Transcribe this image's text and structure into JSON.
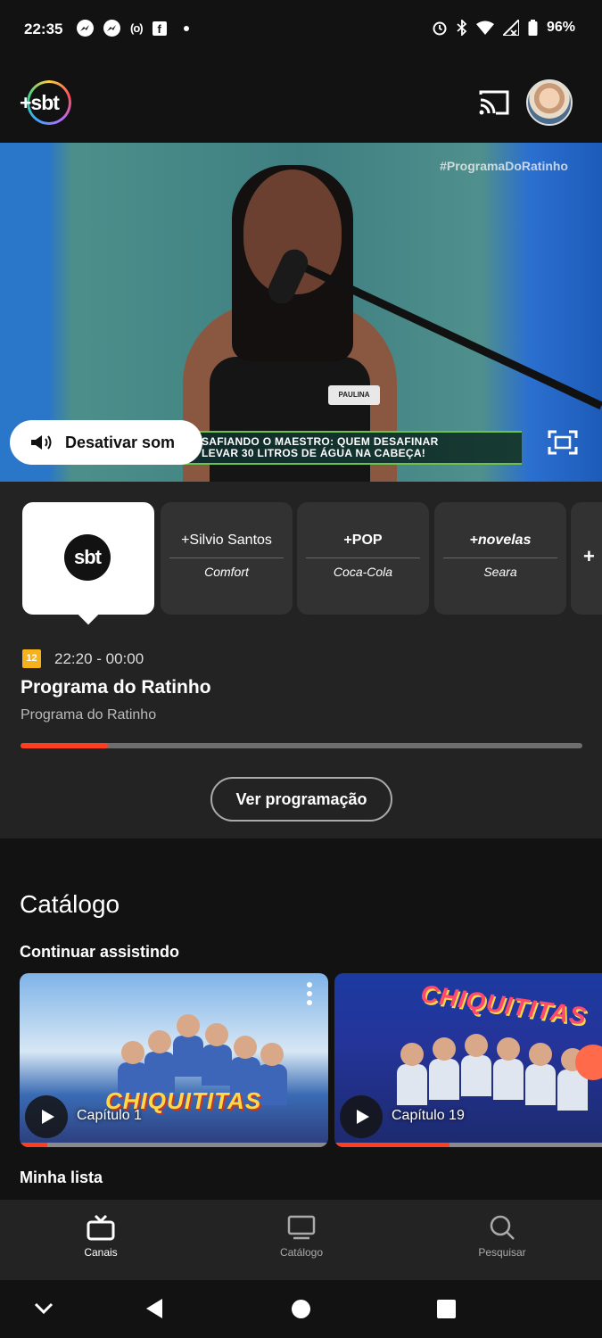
{
  "status_bar": {
    "time": "22:35",
    "battery": "96%",
    "left_icons": [
      "messenger-icon",
      "messenger-icon",
      "hotspot-icon",
      "facebook-icon",
      "dot-icon"
    ],
    "right_icons": [
      "alarm-icon",
      "bluetooth-icon",
      "wifi-icon",
      "signal-icon",
      "battery-icon"
    ]
  },
  "header": {
    "logo_text": "+sbt"
  },
  "video": {
    "hashtag": "#ProgramaDoRatinho",
    "name_badge": "PAULINA",
    "lower_third_line1": "SAFIANDO O MAESTRO: QUEM DESAFINAR",
    "lower_third_line2": "LEVAR 30 LITROS DE ÁGUA NA CABEÇA!",
    "mute_label": "Desativar som"
  },
  "channels": [
    {
      "logo": "sbt",
      "selected": true
    },
    {
      "top": "+Silvio Santos",
      "sponsor": "Comfort"
    },
    {
      "top": "+POP",
      "sponsor": "Coca-Cola"
    },
    {
      "top": "+novelas",
      "sponsor": "Seara"
    },
    {
      "top": "+"
    }
  ],
  "program": {
    "rating": "12",
    "time": "22:20 - 00:00",
    "title": "Programa do Ratinho",
    "subtitle": "Programa do Ratinho",
    "progress": 0.155,
    "schedule_button": "Ver programação"
  },
  "catalog": {
    "title": "Catálogo",
    "continue_title": "Continuar assistindo",
    "items": [
      {
        "show": "CHIQUITITAS",
        "episode": "Capítulo 1",
        "progress": 0.09
      },
      {
        "show": "CHIQUITITAS",
        "episode": "Capítulo 19",
        "progress": 0.43
      }
    ],
    "my_list_title": "Minha lista"
  },
  "bottom_nav": [
    {
      "label": "Canais",
      "icon": "tv-icon",
      "active": true
    },
    {
      "label": "Catálogo",
      "icon": "monitor-icon",
      "active": false
    },
    {
      "label": "Pesquisar",
      "icon": "search-icon",
      "active": false
    }
  ],
  "colors": {
    "accent": "#ff3d1f",
    "background": "#121212",
    "panel": "#232323",
    "rating": "#f6b21a"
  }
}
